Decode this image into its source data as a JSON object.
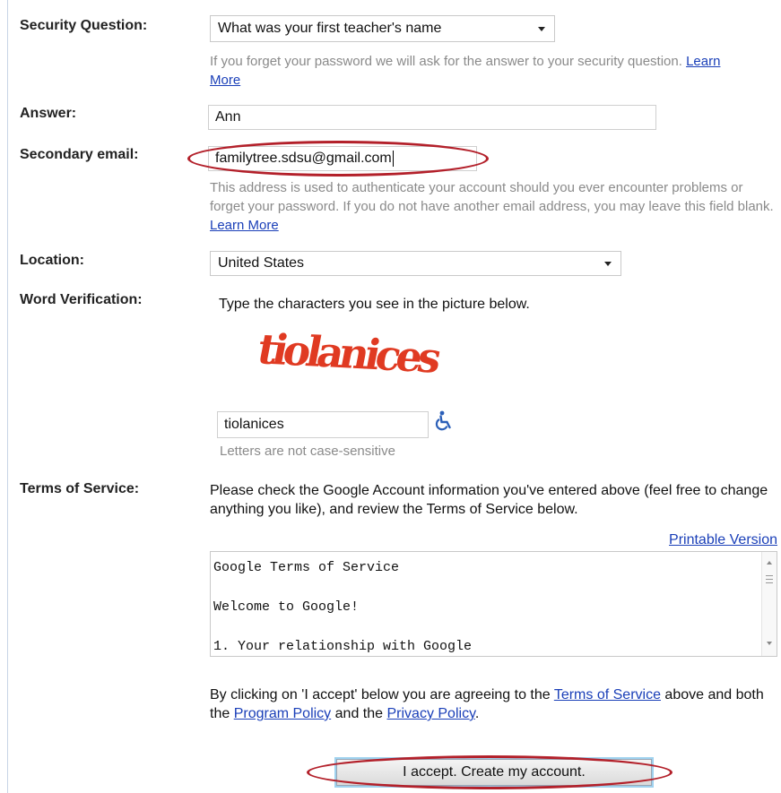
{
  "labels": {
    "security_question": "Security Question:",
    "answer": "Answer:",
    "secondary_email": "Secondary email:",
    "location": "Location:",
    "word_verification": "Word Verification:",
    "terms_of_service": "Terms of Service:"
  },
  "security_question": {
    "selected": "What was your first teacher's name",
    "help": "If you forget your password we will ask for the answer to your security question.",
    "learn_more": "Learn More"
  },
  "answer": {
    "value": "Ann"
  },
  "secondary_email": {
    "value": "familytree.sdsu@gmail.com",
    "help": "This address is used to authenticate your account should you ever encounter problems or forget your password. If you do not have another email address, you may leave this field blank.",
    "learn_more": "Learn More"
  },
  "location": {
    "selected": "United States"
  },
  "word_verification": {
    "instruction": "Type the characters you see in the picture below.",
    "captcha_text": "tiolanices",
    "value": "tiolanices",
    "note": "Letters are not case-sensitive",
    "accessibility_icon": "wheelchair-icon"
  },
  "terms": {
    "intro": "Please check the Google Account information you've entered above (feel free to change anything you like), and review the Terms of Service below.",
    "printable_version": "Printable Version",
    "box_text": "Google Terms of Service\n\nWelcome to Google!\n\n1. Your relationship with Google",
    "agree_1": "By clicking on 'I accept' below you are agreeing to the",
    "terms_link": "Terms of Service",
    "agree_2": "above and both the",
    "program_policy": "Program Policy",
    "agree_3": "and the",
    "privacy_policy": "Privacy Policy",
    "agree_4": "."
  },
  "accept_button": "I accept. Create my account.",
  "colors": {
    "highlight_ellipse": "#b3202a",
    "link": "#1a3fb8",
    "captcha": "#e03a22",
    "accessibility": "#2b5fb8"
  }
}
